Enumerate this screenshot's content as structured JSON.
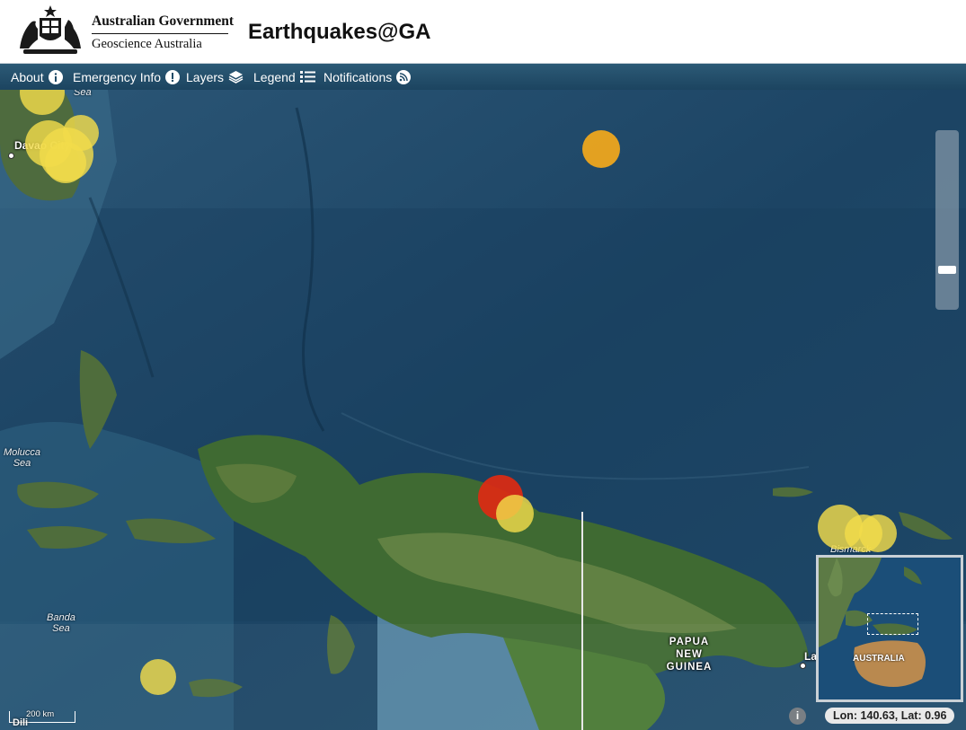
{
  "header": {
    "gov_line1": "Australian Government",
    "gov_line2": "Geoscience Australia",
    "app_title": "Earthquakes@GA"
  },
  "nav": {
    "items": [
      {
        "label": "About",
        "icon": "info-circle-icon"
      },
      {
        "label": "Emergency Info",
        "icon": "exclamation-circle-icon"
      },
      {
        "label": "Layers",
        "icon": "layers-stack-icon"
      },
      {
        "label": "Legend",
        "icon": "list-icon"
      },
      {
        "label": "Notifications",
        "icon": "rss-feed-icon"
      }
    ]
  },
  "map": {
    "labels": {
      "sea_top": "Sea",
      "molucca": "Molucca\nSea",
      "banda": "Banda\nSea",
      "bismarck": "Bismarck"
    },
    "cities": {
      "davao": "Davao City",
      "lae": "Lae",
      "dili": "Dili"
    },
    "country_label": "PAPUA\nNEW\nGUINEA",
    "quake_colors": {
      "yellow": "#f2dc4a",
      "orange": "#eea61e",
      "red": "#dd2a12"
    },
    "overview": {
      "label": "AUSTRALIA"
    },
    "info_button": "i",
    "scale": "200 km",
    "coordinates": "Lon: 140.63, Lat: 0.96"
  }
}
